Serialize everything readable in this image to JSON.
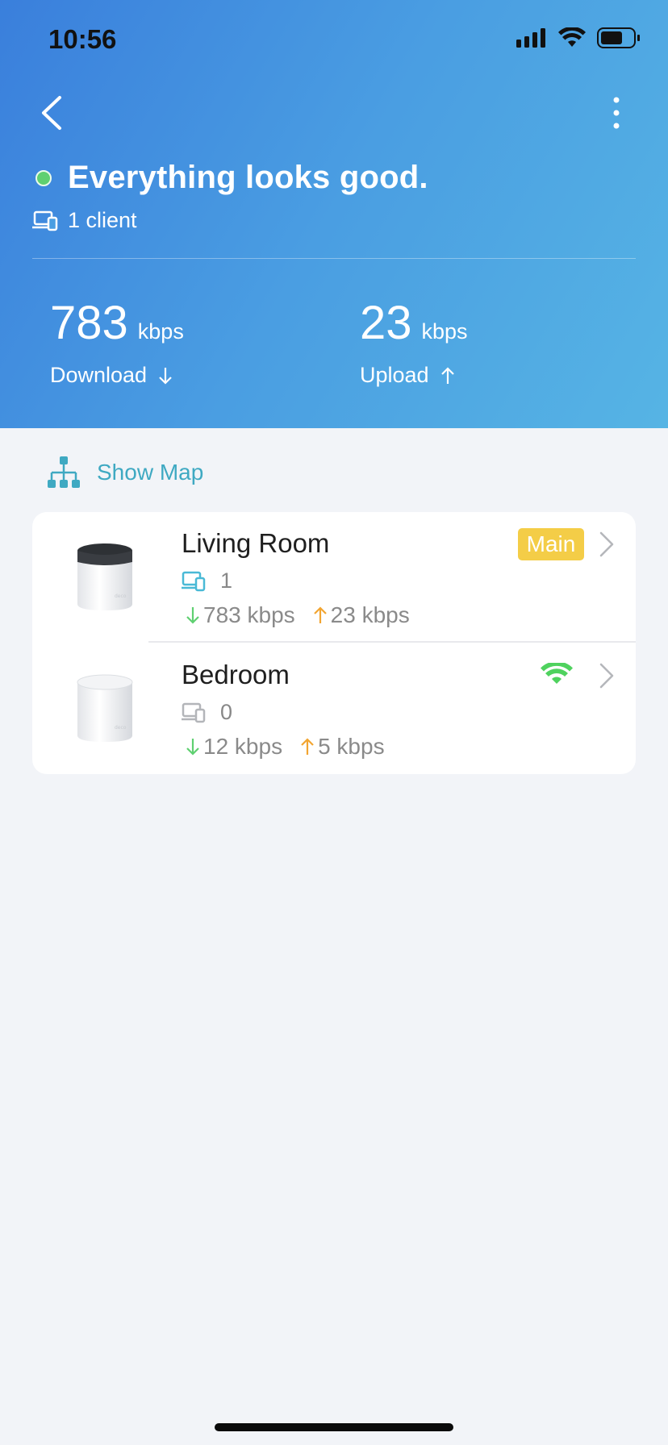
{
  "status_bar": {
    "time": "10:56"
  },
  "header": {
    "health_text": "Everything looks good.",
    "client_text": "1 client",
    "download": {
      "value": "783",
      "unit": "kbps",
      "label": "Download"
    },
    "upload": {
      "value": "23",
      "unit": "kbps",
      "label": "Upload"
    }
  },
  "show_map_label": "Show Map",
  "nodes": [
    {
      "name": "Living Room",
      "badge": "Main",
      "clients": "1",
      "download": "783 kbps",
      "upload": "23 kbps"
    },
    {
      "name": "Bedroom",
      "clients": "0",
      "download": "12 kbps",
      "upload": "5 kbps"
    }
  ],
  "colors": {
    "accent": "#3fa9c2",
    "good": "#5fd071",
    "download_arrow": "#5fd071",
    "upload_arrow": "#f2a531",
    "main_badge": "#f4cd47"
  },
  "icons": [
    "back-icon",
    "more-icon",
    "client-device-icon",
    "download-arrow-icon",
    "upload-arrow-icon",
    "network-map-icon",
    "router-icon",
    "chevron-right-icon",
    "wifi-signal-icon"
  ]
}
